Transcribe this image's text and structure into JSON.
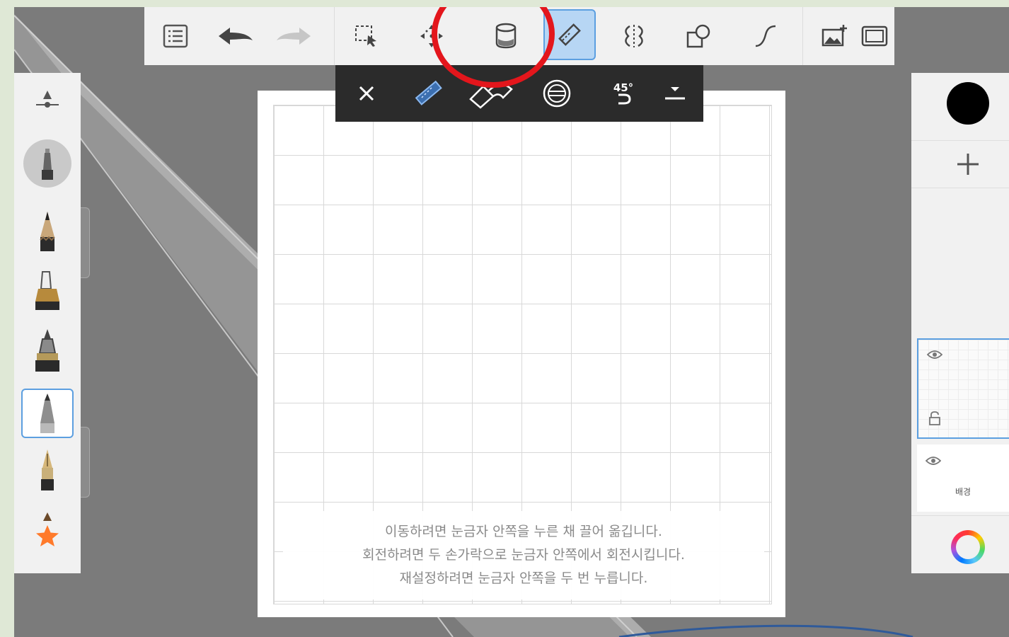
{
  "toolbar": {
    "icons": [
      "menu-list-icon",
      "undo-icon",
      "redo-icon",
      "selection-icon",
      "transform-icon",
      "fill-bucket-icon",
      "ruler-guide-icon",
      "symmetry-icon",
      "shape-icon",
      "curve-icon",
      "add-image-icon",
      "fullscreen-icon"
    ],
    "active_tool": "ruler-guide-icon"
  },
  "ruler_toolbar": {
    "angle_label": "45°",
    "icons": [
      "close-icon",
      "straight-ruler-icon",
      "french-curve-icon",
      "ellipse-guide-icon",
      "angle-snap-icon",
      "collapse-icon"
    ]
  },
  "brushes": [
    "brush-size-icon",
    "airbrush-icon",
    "pencil-icon",
    "marker-icon",
    "chisel-pen-icon",
    "ballpoint-pen-icon",
    "fountain-pen-icon",
    "favorite-star-icon"
  ],
  "layers": {
    "current_color": "#000000",
    "add_label": "+",
    "background_label": "배경"
  },
  "hint": {
    "line1": "이동하려면 눈금자 안쪽을 누른 채 끌어 옮깁니다.",
    "line2": "회전하려면 두 손가락으로 눈금자 안쪽에서 회전시킵니다.",
    "line3": "재설정하려면 눈금자 안쪽을 두 번 누릅니다."
  },
  "colors": {
    "accent": "#5c9fe0",
    "annotation_circle": "#e3161c",
    "workspace": "#7b7b7b",
    "panel": "#f1f1f1"
  }
}
